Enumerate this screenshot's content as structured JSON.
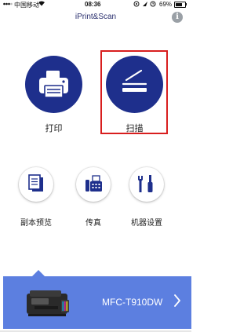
{
  "status_bar": {
    "carrier": "中国移动",
    "time": "08:36",
    "battery_pct": "69%",
    "battery_level": 0.69
  },
  "header": {
    "title": "iPrint&Scan",
    "info_label": "i"
  },
  "main_actions": [
    {
      "label": "打印",
      "icon": "printer-icon"
    },
    {
      "label": "扫描",
      "icon": "scanner-icon",
      "highlighted": true
    }
  ],
  "secondary_actions": [
    {
      "label": "副本预览",
      "icon": "copy-document-icon"
    },
    {
      "label": "传真",
      "icon": "fax-icon"
    },
    {
      "label": "机器设置",
      "icon": "tools-icon"
    }
  ],
  "device": {
    "name": "MFC-T910DW"
  },
  "colors": {
    "primary_blue": "#1e2f8c",
    "device_bar": "#5c7fe0",
    "highlight_red": "#d81e1e"
  }
}
